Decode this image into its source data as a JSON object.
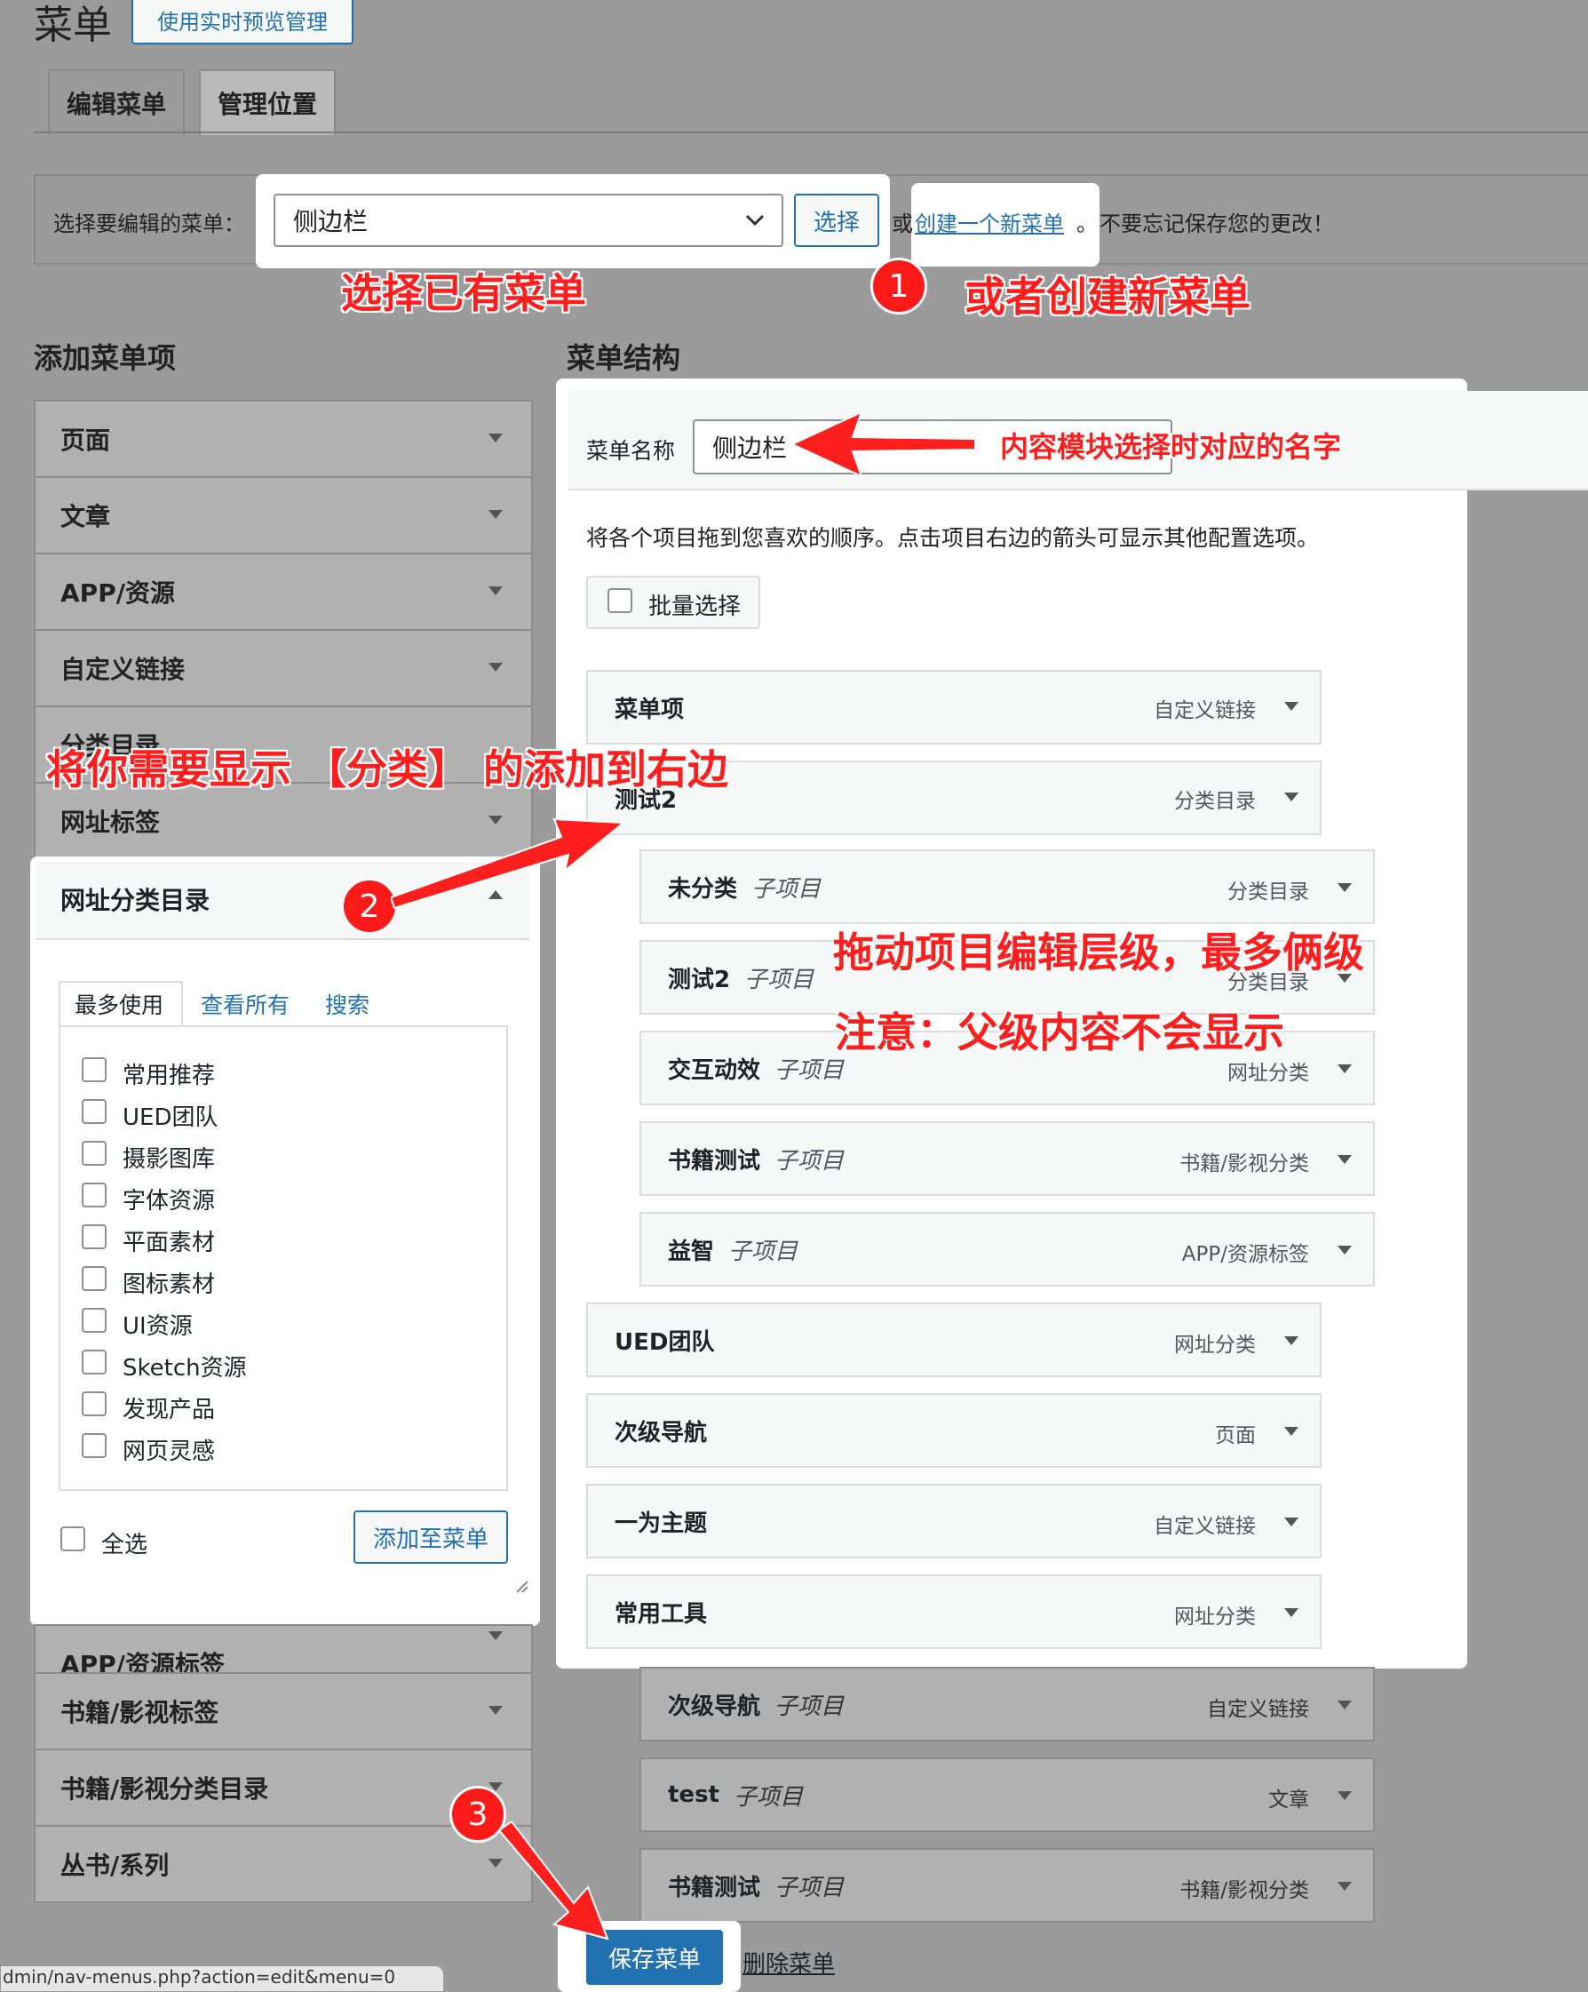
{
  "header": {
    "title": "菜单",
    "live_preview_btn": "使用实时预览管理",
    "tabs": [
      "编辑菜单",
      "管理位置"
    ]
  },
  "select_bar": {
    "label": "选择要编辑的菜单：",
    "selected": "侧边栏",
    "select_btn": "选择",
    "or": "或",
    "create_link": "创建一个新菜单",
    "period": "。",
    "reminder": "不要忘记保存您的更改！"
  },
  "left": {
    "title": "添加菜单项",
    "sections": [
      "页面",
      "文章",
      "APP/资源",
      "自定义链接",
      "分类目录",
      "网址标签"
    ],
    "open_section": "网址分类目录",
    "subtabs": [
      "最多使用",
      "查看所有",
      "搜索"
    ],
    "checkbox_items": [
      "常用推荐",
      "UED团队",
      "摄影图库",
      "字体资源",
      "平面素材",
      "图标素材",
      "UI资源",
      "Sketch资源",
      "发现产品",
      "网页灵感"
    ],
    "select_all": "全选",
    "add_btn": "添加至菜单",
    "more_sections": [
      "APP/资源标签",
      "书籍/影视标签",
      "书籍/影视分类目录",
      "丛书/系列"
    ]
  },
  "right": {
    "title": "菜单结构",
    "name_label": "菜单名称",
    "name_value": "侧边栏",
    "hint": "将各个项目拖到您喜欢的顺序。点击项目右边的箭头可显示其他配置选项。",
    "bulk_select": "批量选择",
    "items": [
      {
        "title": "菜单项",
        "sub": "",
        "type": "自定义链接"
      },
      {
        "title": "测试2",
        "sub": "",
        "type": "分类目录"
      },
      {
        "title": "未分类",
        "sub": "子项目",
        "type": "分类目录"
      },
      {
        "title": "测试2",
        "sub": "子项目",
        "type": "分类目录"
      },
      {
        "title": "交互动效",
        "sub": "子项目",
        "type": "网址分类"
      },
      {
        "title": "书籍测试",
        "sub": "子项目",
        "type": "书籍/影视分类"
      },
      {
        "title": "益智",
        "sub": "子项目",
        "type": "APP/资源标签"
      },
      {
        "title": "UED团队",
        "sub": "",
        "type": "网址分类"
      },
      {
        "title": "次级导航",
        "sub": "",
        "type": "页面"
      },
      {
        "title": "一为主题",
        "sub": "",
        "type": "自定义链接"
      },
      {
        "title": "常用工具",
        "sub": "",
        "type": "网址分类"
      },
      {
        "title": "次级导航",
        "sub": "子项目",
        "type": "自定义链接"
      },
      {
        "title": "test",
        "sub": "子项目",
        "type": "文章"
      },
      {
        "title": "书籍测试",
        "sub": "子项目",
        "type": "书籍/影视分类"
      }
    ],
    "save_btn": "保存菜单",
    "delete_link": "删除菜单"
  },
  "status_url": "dmin/nav-menus.php?action=edit&menu=0",
  "annotations": {
    "a1": "选择已有菜单",
    "a2": "或者创建新菜单",
    "a3": "内容模块选择时对应的名字",
    "a4": "将你需要显示 【分类】 的添加到右边",
    "a5": "拖动项目编辑层级，最多俩级",
    "a6": "注意：父级内容不会显示",
    "badge1": "1",
    "badge2": "2",
    "badge3": "3"
  },
  "colors": {
    "accent": "#2271b1",
    "annotation_red": "#ff1e1e",
    "backdrop": "#9b9b9b"
  }
}
